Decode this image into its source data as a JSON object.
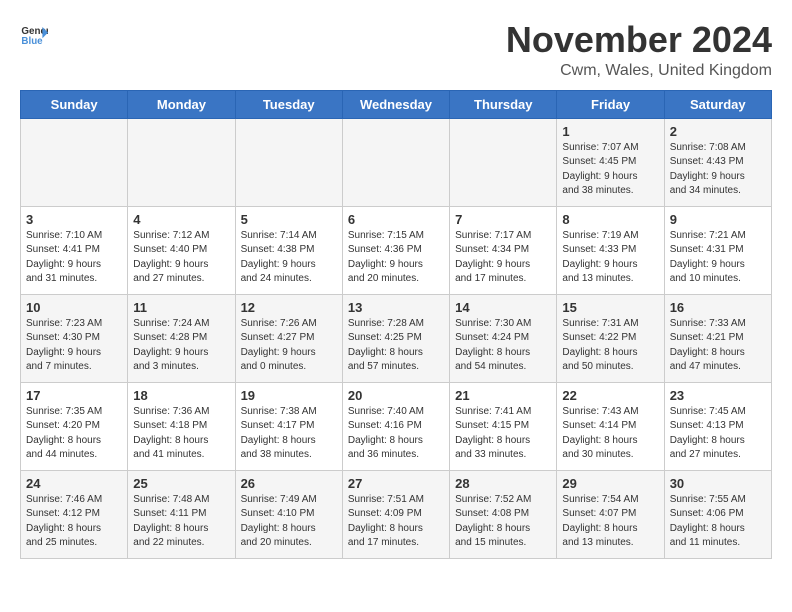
{
  "header": {
    "logo_general": "General",
    "logo_blue": "Blue",
    "month_title": "November 2024",
    "location": "Cwm, Wales, United Kingdom"
  },
  "days_of_week": [
    "Sunday",
    "Monday",
    "Tuesday",
    "Wednesday",
    "Thursday",
    "Friday",
    "Saturday"
  ],
  "weeks": [
    [
      {
        "day": "",
        "info": ""
      },
      {
        "day": "",
        "info": ""
      },
      {
        "day": "",
        "info": ""
      },
      {
        "day": "",
        "info": ""
      },
      {
        "day": "",
        "info": ""
      },
      {
        "day": "1",
        "info": "Sunrise: 7:07 AM\nSunset: 4:45 PM\nDaylight: 9 hours\nand 38 minutes."
      },
      {
        "day": "2",
        "info": "Sunrise: 7:08 AM\nSunset: 4:43 PM\nDaylight: 9 hours\nand 34 minutes."
      }
    ],
    [
      {
        "day": "3",
        "info": "Sunrise: 7:10 AM\nSunset: 4:41 PM\nDaylight: 9 hours\nand 31 minutes."
      },
      {
        "day": "4",
        "info": "Sunrise: 7:12 AM\nSunset: 4:40 PM\nDaylight: 9 hours\nand 27 minutes."
      },
      {
        "day": "5",
        "info": "Sunrise: 7:14 AM\nSunset: 4:38 PM\nDaylight: 9 hours\nand 24 minutes."
      },
      {
        "day": "6",
        "info": "Sunrise: 7:15 AM\nSunset: 4:36 PM\nDaylight: 9 hours\nand 20 minutes."
      },
      {
        "day": "7",
        "info": "Sunrise: 7:17 AM\nSunset: 4:34 PM\nDaylight: 9 hours\nand 17 minutes."
      },
      {
        "day": "8",
        "info": "Sunrise: 7:19 AM\nSunset: 4:33 PM\nDaylight: 9 hours\nand 13 minutes."
      },
      {
        "day": "9",
        "info": "Sunrise: 7:21 AM\nSunset: 4:31 PM\nDaylight: 9 hours\nand 10 minutes."
      }
    ],
    [
      {
        "day": "10",
        "info": "Sunrise: 7:23 AM\nSunset: 4:30 PM\nDaylight: 9 hours\nand 7 minutes."
      },
      {
        "day": "11",
        "info": "Sunrise: 7:24 AM\nSunset: 4:28 PM\nDaylight: 9 hours\nand 3 minutes."
      },
      {
        "day": "12",
        "info": "Sunrise: 7:26 AM\nSunset: 4:27 PM\nDaylight: 9 hours\nand 0 minutes."
      },
      {
        "day": "13",
        "info": "Sunrise: 7:28 AM\nSunset: 4:25 PM\nDaylight: 8 hours\nand 57 minutes."
      },
      {
        "day": "14",
        "info": "Sunrise: 7:30 AM\nSunset: 4:24 PM\nDaylight: 8 hours\nand 54 minutes."
      },
      {
        "day": "15",
        "info": "Sunrise: 7:31 AM\nSunset: 4:22 PM\nDaylight: 8 hours\nand 50 minutes."
      },
      {
        "day": "16",
        "info": "Sunrise: 7:33 AM\nSunset: 4:21 PM\nDaylight: 8 hours\nand 47 minutes."
      }
    ],
    [
      {
        "day": "17",
        "info": "Sunrise: 7:35 AM\nSunset: 4:20 PM\nDaylight: 8 hours\nand 44 minutes."
      },
      {
        "day": "18",
        "info": "Sunrise: 7:36 AM\nSunset: 4:18 PM\nDaylight: 8 hours\nand 41 minutes."
      },
      {
        "day": "19",
        "info": "Sunrise: 7:38 AM\nSunset: 4:17 PM\nDaylight: 8 hours\nand 38 minutes."
      },
      {
        "day": "20",
        "info": "Sunrise: 7:40 AM\nSunset: 4:16 PM\nDaylight: 8 hours\nand 36 minutes."
      },
      {
        "day": "21",
        "info": "Sunrise: 7:41 AM\nSunset: 4:15 PM\nDaylight: 8 hours\nand 33 minutes."
      },
      {
        "day": "22",
        "info": "Sunrise: 7:43 AM\nSunset: 4:14 PM\nDaylight: 8 hours\nand 30 minutes."
      },
      {
        "day": "23",
        "info": "Sunrise: 7:45 AM\nSunset: 4:13 PM\nDaylight: 8 hours\nand 27 minutes."
      }
    ],
    [
      {
        "day": "24",
        "info": "Sunrise: 7:46 AM\nSunset: 4:12 PM\nDaylight: 8 hours\nand 25 minutes."
      },
      {
        "day": "25",
        "info": "Sunrise: 7:48 AM\nSunset: 4:11 PM\nDaylight: 8 hours\nand 22 minutes."
      },
      {
        "day": "26",
        "info": "Sunrise: 7:49 AM\nSunset: 4:10 PM\nDaylight: 8 hours\nand 20 minutes."
      },
      {
        "day": "27",
        "info": "Sunrise: 7:51 AM\nSunset: 4:09 PM\nDaylight: 8 hours\nand 17 minutes."
      },
      {
        "day": "28",
        "info": "Sunrise: 7:52 AM\nSunset: 4:08 PM\nDaylight: 8 hours\nand 15 minutes."
      },
      {
        "day": "29",
        "info": "Sunrise: 7:54 AM\nSunset: 4:07 PM\nDaylight: 8 hours\nand 13 minutes."
      },
      {
        "day": "30",
        "info": "Sunrise: 7:55 AM\nSunset: 4:06 PM\nDaylight: 8 hours\nand 11 minutes."
      }
    ]
  ]
}
